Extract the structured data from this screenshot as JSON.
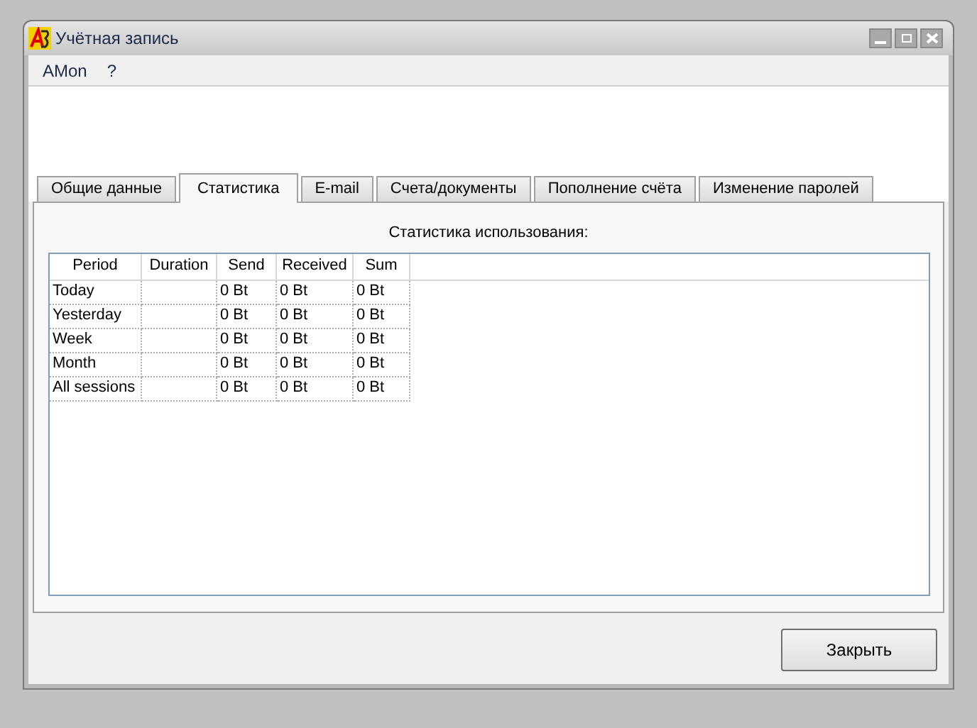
{
  "window": {
    "title": "Учётная запись"
  },
  "menu": [
    "AMon",
    "?"
  ],
  "tabs": [
    {
      "label": "Общие данные",
      "selected": false
    },
    {
      "label": "Статистика",
      "selected": true
    },
    {
      "label": "E-mail",
      "selected": false
    },
    {
      "label": "Счета/документы",
      "selected": false
    },
    {
      "label": "Пополнение счёта",
      "selected": false
    },
    {
      "label": "Изменение паролей",
      "selected": false
    }
  ],
  "section_title": "Статистика использования:",
  "table": {
    "columns": [
      "Period",
      "Duration",
      "Send",
      "Received",
      "Sum"
    ],
    "rows": [
      [
        "Today",
        "",
        "0 Bt",
        "0 Bt",
        "0 Bt"
      ],
      [
        "Yesterday",
        "",
        "0 Bt",
        "0 Bt",
        "0 Bt"
      ],
      [
        "Week",
        "",
        "0 Bt",
        "0 Bt",
        "0 Bt"
      ],
      [
        "Month",
        "",
        "0 Bt",
        "0 Bt",
        "0 Bt"
      ],
      [
        "All sessions",
        "",
        "0 Bt",
        "0 Bt",
        "0 Bt"
      ]
    ]
  },
  "buttons": [
    "Закрыть"
  ]
}
